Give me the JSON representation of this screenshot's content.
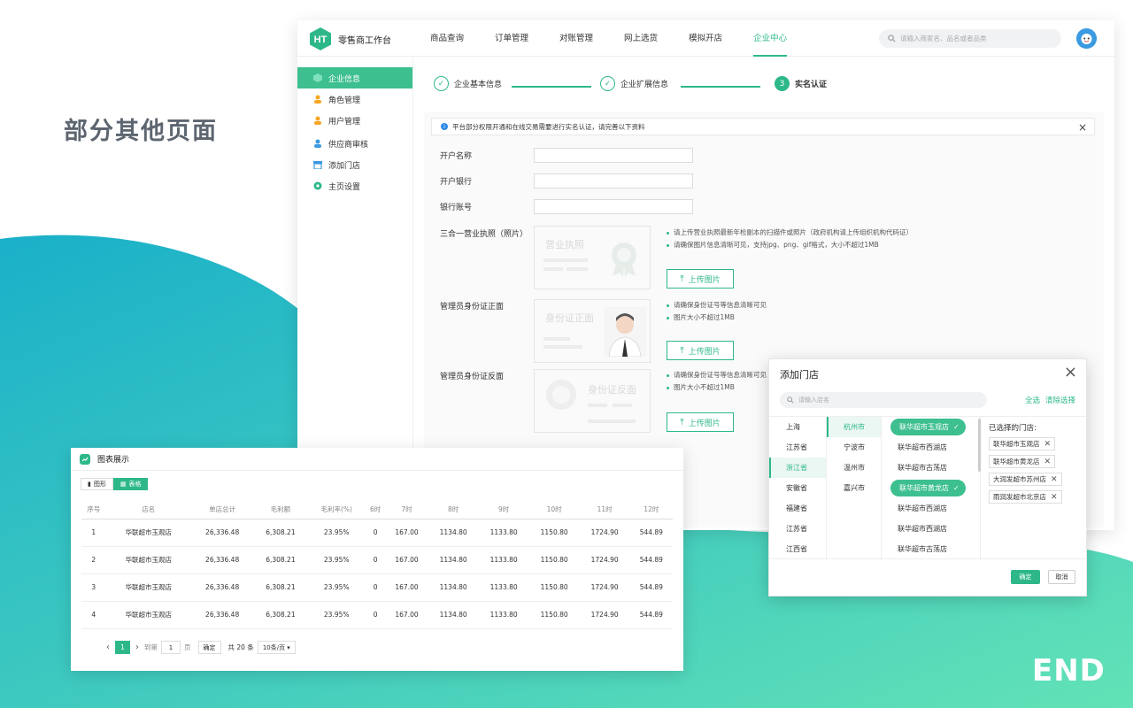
{
  "slide": {
    "title": "部分其他页面",
    "end": "END"
  },
  "app": {
    "name": "零售商工作台",
    "nav": [
      "商品查询",
      "订单管理",
      "对账管理",
      "网上选货",
      "模拟开店",
      "企业中心"
    ],
    "search_placeholder": "请输入商家名、品名或者品类"
  },
  "sidebar": {
    "items": [
      {
        "label": "企业信息"
      },
      {
        "label": "角色管理"
      },
      {
        "label": "用户管理"
      },
      {
        "label": "供应商审核"
      },
      {
        "label": "添加门店"
      },
      {
        "label": "主页设置"
      }
    ]
  },
  "steps": [
    {
      "label": "企业基本信息",
      "mark": "✓"
    },
    {
      "label": "企业扩展信息",
      "mark": "✓"
    },
    {
      "label": "实名认证",
      "mark": "3"
    }
  ],
  "form": {
    "notice_icon": "i",
    "notice": "平台部分权限开通和在线交易需要进行实名认证，请完善以下资料",
    "fields": [
      "开户名称",
      "开户银行",
      "银行账号"
    ],
    "license_label": "三合一营业执照（照片）",
    "license_placeholder": "营业执照",
    "license_tips": [
      "请上传营业执照最新年检副本的扫描件或照片（政府机构请上传组织机构代码证）",
      "请确保图片信息清晰可见，支持jpg、png、gif格式，大小不超过1MB"
    ],
    "id_front_label": "管理员身份证正面",
    "id_front_placeholder": "身份证正面",
    "id_front_tips": [
      "请确保身份证号等信息清晰可见",
      "图片大小不超过1MB"
    ],
    "id_back_label": "管理员身份证反面",
    "id_back_placeholder": "身份证反面",
    "id_back_tips": [
      "请确保身份证号等信息清晰可见",
      "图片大小不超过1MB"
    ],
    "upload_label": "上传图片"
  },
  "dialog": {
    "title": "添加门店",
    "search_placeholder": "请输入店名",
    "select_all": "全选",
    "clear": "清除选择",
    "provinces": [
      "上海",
      "江苏省",
      "浙江省",
      "安徽省",
      "福建省",
      "江苏省",
      "江西省"
    ],
    "cities": [
      "杭州市",
      "宁波市",
      "温州市",
      "嘉兴市"
    ],
    "stores": [
      {
        "name": "联华超市玉观店",
        "selected": true
      },
      {
        "name": "联华超市西湖店",
        "selected": false
      },
      {
        "name": "联华超市古荡店",
        "selected": false
      },
      {
        "name": "联华超市黄龙店",
        "selected": true
      },
      {
        "name": "联华超市西湖店",
        "selected": false
      },
      {
        "name": "联华超市西湖店",
        "selected": false
      },
      {
        "name": "联华超市古荡店",
        "selected": false
      }
    ],
    "selected_title": "已选择的门店:",
    "selected": [
      "联华超市玉观店",
      "联华超市黄龙店",
      "大润发超市苏州店",
      "雨润发超市北京店"
    ],
    "ok": "确定",
    "cancel": "取消"
  },
  "chart_window": {
    "title": "图表展示",
    "tabs": [
      "图形",
      "表格"
    ],
    "headers": [
      "序号",
      "店名",
      "单店总计",
      "毛利额",
      "毛利率(%)",
      "6时",
      "7时",
      "8时",
      "9时",
      "10时",
      "11时",
      "12时"
    ],
    "rows": [
      [
        "1",
        "华联超市玉观店",
        "26,336.48",
        "6,308.21",
        "23.95%",
        "0",
        "167.00",
        "1134.80",
        "1133.80",
        "1150.80",
        "1724.90",
        "544.89"
      ],
      [
        "2",
        "华联超市玉观店",
        "26,336.48",
        "6,308.21",
        "23.95%",
        "0",
        "167.00",
        "1134.80",
        "1133.80",
        "1150.80",
        "1724.90",
        "544.89"
      ],
      [
        "3",
        "华联超市玉观店",
        "26,336.48",
        "6,308.21",
        "23.95%",
        "0",
        "167.00",
        "1134.80",
        "1133.80",
        "1150.80",
        "1724.90",
        "544.89"
      ],
      [
        "4",
        "华联超市玉观店",
        "26,336.48",
        "6,308.21",
        "23.95%",
        "0",
        "167.00",
        "1134.80",
        "1133.80",
        "1150.80",
        "1724.90",
        "544.89"
      ]
    ],
    "pager": {
      "current": "1",
      "goto_prefix": "到第",
      "goto_value": "1",
      "goto_suffix": "页",
      "confirm": "确定",
      "total": "共 20 条",
      "page_size": "10条/页 ▾"
    }
  },
  "colors": {
    "accent": "#2eb88a",
    "wave_start": "#1fb5c6",
    "wave_end": "#5fe0b8"
  }
}
